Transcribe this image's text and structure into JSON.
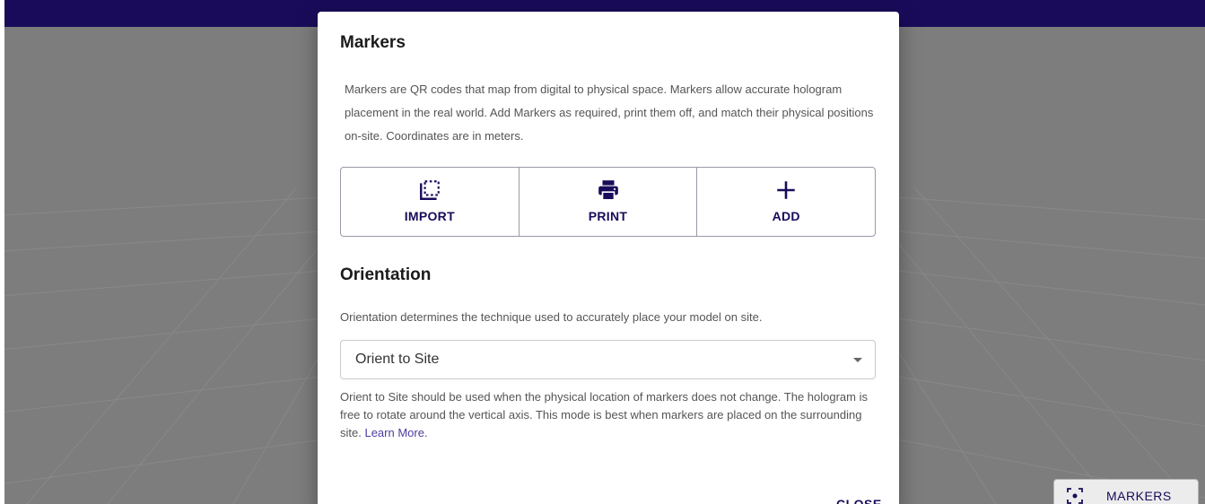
{
  "colors": {
    "brand": "#1a0b5a",
    "link": "#4b3d9e",
    "viewport_bg": "#7d7d7d"
  },
  "modal": {
    "markers": {
      "title": "Markers",
      "description": "Markers are QR codes that map from digital to physical space. Markers allow accurate hologram placement in the real world. Add Markers as required, print them off, and match their physical positions on-site. Coordinates are in meters.",
      "buttons": [
        {
          "label": "IMPORT",
          "icon": "import-icon"
        },
        {
          "label": "PRINT",
          "icon": "printer-icon"
        },
        {
          "label": "ADD",
          "icon": "plus-icon"
        }
      ]
    },
    "orientation": {
      "title": "Orientation",
      "description": "Orientation determines the technique used to accurately place your model on site.",
      "select": {
        "value": "Orient to Site"
      },
      "mode_description": "Orient to Site should be used when the physical location of markers does not change. The hologram is free to rotate around the vertical axis. This mode is best when markers are placed on the surrounding site.",
      "learn_more": "Learn More."
    },
    "close_label": "CLOSE"
  },
  "fab": {
    "label": "MARKERS",
    "icon": "marker-scan-icon"
  }
}
